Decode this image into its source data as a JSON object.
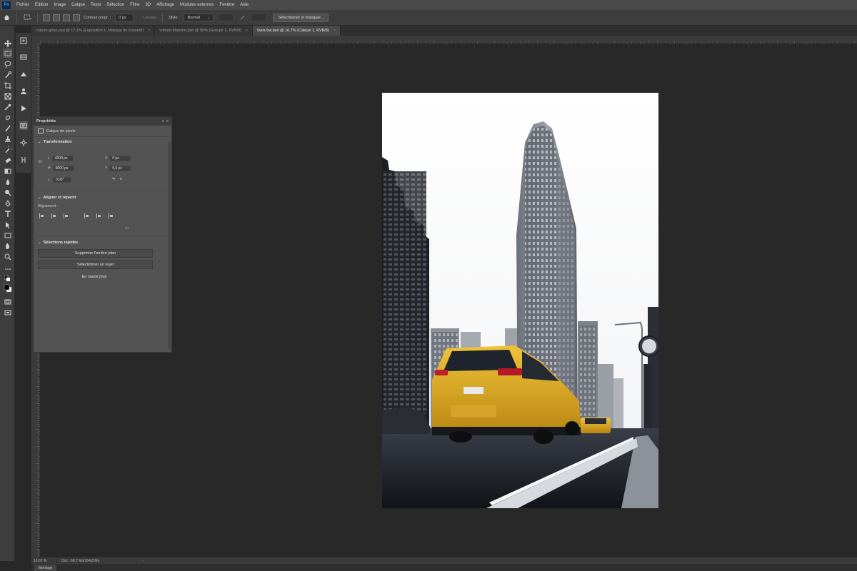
{
  "app": {
    "logo": "Ps",
    "menu": [
      "Fichier",
      "Edition",
      "Image",
      "Calque",
      "Texte",
      "Sélection",
      "Filtre",
      "3D",
      "Affichage",
      "Modules externes",
      "Fenêtre",
      "Aide"
    ]
  },
  "options": {
    "feather_label": "Contour progr. :",
    "feather_value": "0 px",
    "smooth_label": "Lissage",
    "style_label": "Style :",
    "style_value": "Normal",
    "select_mask_button": "Sélectionner et masquer..."
  },
  "tabs": [
    {
      "label": "voiture-grise.psd @ 17,1% (Exposition 1, Masque de fusion/8)",
      "active": false
    },
    {
      "label": "voiture-blanche.psd @ 50% (Groupe 1, RVB/8)",
      "active": false
    },
    {
      "label": "taxis-bw.psd @ 16,7% (Calque 1, RVB/8)",
      "active": true
    }
  ],
  "properties": {
    "panel_title": "Propriétés",
    "layer_type": "Calque de pixels",
    "transform_title": "Transformation",
    "w_label": "L",
    "w_value": "4000 px",
    "x_label": "X",
    "x_value": "0 px",
    "h_label": "H",
    "h_value": "6000 px",
    "y_label": "Y",
    "y_value": "0,6 px",
    "angle_value": "0,00°",
    "align_title": "Aligner et répartir",
    "align_label": "Alignement :",
    "more": "•••",
    "quick_title": "Sélections rapides",
    "remove_bg_button": "Supprimer l'arrière-plan",
    "select_subject_button": "Sélectionner un sujet",
    "learn_more": "En savoir plus"
  },
  "status": {
    "zoom": "16,67 %",
    "doc": "Doc : 68,7 Mo/164,8 Mo",
    "arrow": "›"
  },
  "timeline": {
    "label": "Montage"
  },
  "colors": {
    "taxi": "#e0a91a",
    "accent": "#31a8ff"
  }
}
